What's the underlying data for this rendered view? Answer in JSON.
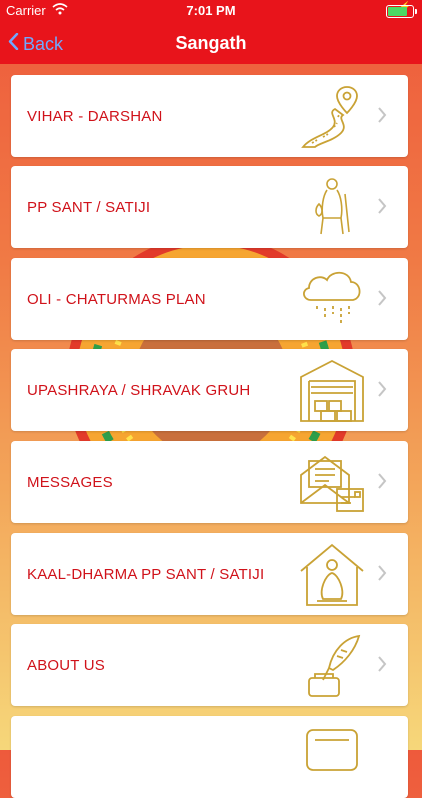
{
  "status": {
    "carrier": "Carrier",
    "time": "7:01 PM"
  },
  "nav": {
    "back_label": "Back",
    "title": "Sangath"
  },
  "menu": [
    {
      "label": "VIHAR - DARSHAN",
      "icon": "winding-road-pin-icon"
    },
    {
      "label": "PP SANT / SATIJI",
      "icon": "walking-monk-icon"
    },
    {
      "label": "OLI - CHATURMAS PLAN",
      "icon": "rain-cloud-icon"
    },
    {
      "label": "UPASHRAYA / SHRAVAK GRUH",
      "icon": "warehouse-icon"
    },
    {
      "label": "MESSAGES",
      "icon": "envelope-letter-icon"
    },
    {
      "label": "KAAL-DHARMA PP SANT / SATIJI",
      "icon": "meditating-figure-house-icon"
    },
    {
      "label": "ABOUT US",
      "icon": "quill-inkpot-icon"
    },
    {
      "label": "",
      "icon": "document-icon"
    }
  ],
  "colors": {
    "accent": "#e8141b",
    "label": "#d0121a",
    "icon": "#c9a235"
  }
}
